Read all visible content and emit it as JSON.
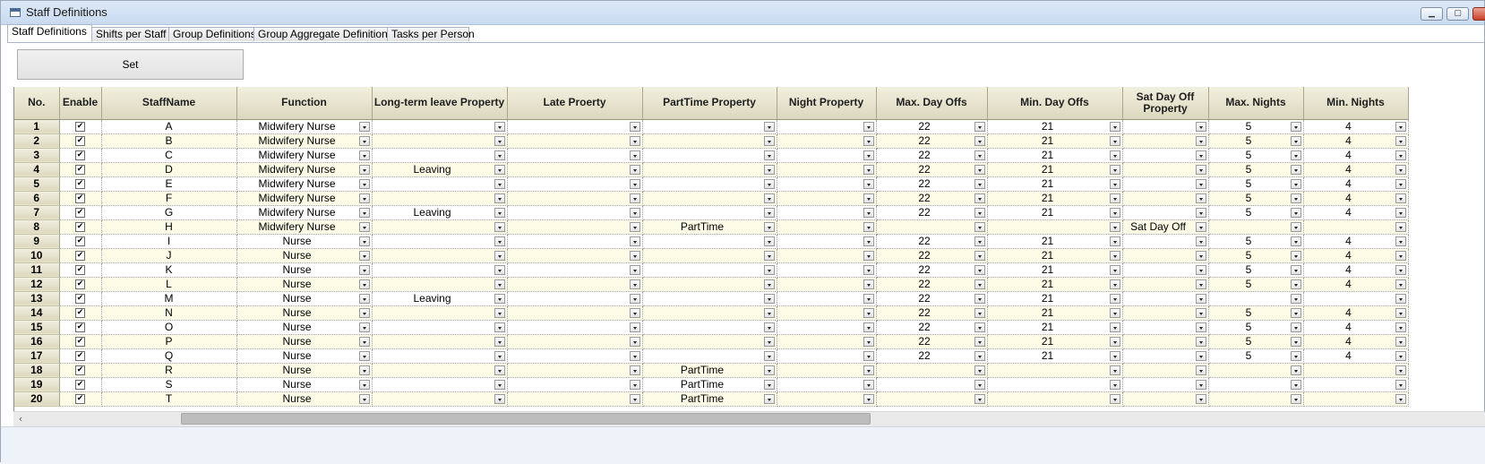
{
  "window": {
    "title": "Staff Definitions",
    "min_symbol": "▁",
    "max_symbol": "▢",
    "close_symbol": ""
  },
  "tabs": [
    "Staff Definitions",
    "Shifts per Staff",
    "Group Definitions",
    "Group Aggregate Definitions",
    "Tasks per Person"
  ],
  "set_button": "Set",
  "columns": [
    "No.",
    "Enable",
    "StaffName",
    "Function",
    "Long-term leave Property",
    "Late Proerty",
    "PartTime Property",
    "Night Property",
    "Max. Day Offs",
    "Min. Day Offs",
    "Sat Day Off Property",
    "Max. Nights",
    "Min. Nights"
  ],
  "check_symbol": "✔",
  "scroll_left_symbol": "‹",
  "rows": [
    {
      "no": "1",
      "name": "A",
      "function": "Midwifery Nurse",
      "leave": "",
      "late": "",
      "parttime": "",
      "night": "",
      "max_off": "22",
      "min_off": "21",
      "sat": "",
      "max_n": "5",
      "min_n": "4"
    },
    {
      "no": "2",
      "name": "B",
      "function": "Midwifery Nurse",
      "leave": "",
      "late": "",
      "parttime": "",
      "night": "",
      "max_off": "22",
      "min_off": "21",
      "sat": "",
      "max_n": "5",
      "min_n": "4"
    },
    {
      "no": "3",
      "name": "C",
      "function": "Midwifery Nurse",
      "leave": "",
      "late": "",
      "parttime": "",
      "night": "",
      "max_off": "22",
      "min_off": "21",
      "sat": "",
      "max_n": "5",
      "min_n": "4"
    },
    {
      "no": "4",
      "name": "D",
      "function": "Midwifery Nurse",
      "leave": "Leaving",
      "late": "",
      "parttime": "",
      "night": "",
      "max_off": "22",
      "min_off": "21",
      "sat": "",
      "max_n": "5",
      "min_n": "4"
    },
    {
      "no": "5",
      "name": "E",
      "function": "Midwifery Nurse",
      "leave": "",
      "late": "",
      "parttime": "",
      "night": "",
      "max_off": "22",
      "min_off": "21",
      "sat": "",
      "max_n": "5",
      "min_n": "4"
    },
    {
      "no": "6",
      "name": "F",
      "function": "Midwifery Nurse",
      "leave": "",
      "late": "",
      "parttime": "",
      "night": "",
      "max_off": "22",
      "min_off": "21",
      "sat": "",
      "max_n": "5",
      "min_n": "4"
    },
    {
      "no": "7",
      "name": "G",
      "function": "Midwifery Nurse",
      "leave": "Leaving",
      "late": "",
      "parttime": "",
      "night": "",
      "max_off": "22",
      "min_off": "21",
      "sat": "",
      "max_n": "5",
      "min_n": "4"
    },
    {
      "no": "8",
      "name": "H",
      "function": "Midwifery Nurse",
      "leave": "",
      "late": "",
      "parttime": "PartTime",
      "night": "",
      "max_off": "",
      "min_off": "",
      "sat": "Sat Day Off",
      "max_n": "",
      "min_n": ""
    },
    {
      "no": "9",
      "name": "I",
      "function": "Nurse",
      "leave": "",
      "late": "",
      "parttime": "",
      "night": "",
      "max_off": "22",
      "min_off": "21",
      "sat": "",
      "max_n": "5",
      "min_n": "4"
    },
    {
      "no": "10",
      "name": "J",
      "function": "Nurse",
      "leave": "",
      "late": "",
      "parttime": "",
      "night": "",
      "max_off": "22",
      "min_off": "21",
      "sat": "",
      "max_n": "5",
      "min_n": "4"
    },
    {
      "no": "11",
      "name": "K",
      "function": "Nurse",
      "leave": "",
      "late": "",
      "parttime": "",
      "night": "",
      "max_off": "22",
      "min_off": "21",
      "sat": "",
      "max_n": "5",
      "min_n": "4"
    },
    {
      "no": "12",
      "name": "L",
      "function": "Nurse",
      "leave": "",
      "late": "",
      "parttime": "",
      "night": "",
      "max_off": "22",
      "min_off": "21",
      "sat": "",
      "max_n": "5",
      "min_n": "4"
    },
    {
      "no": "13",
      "name": "M",
      "function": "Nurse",
      "leave": "Leaving",
      "late": "",
      "parttime": "",
      "night": "",
      "max_off": "22",
      "min_off": "21",
      "sat": "",
      "max_n": "",
      "min_n": ""
    },
    {
      "no": "14",
      "name": "N",
      "function": "Nurse",
      "leave": "",
      "late": "",
      "parttime": "",
      "night": "",
      "max_off": "22",
      "min_off": "21",
      "sat": "",
      "max_n": "5",
      "min_n": "4"
    },
    {
      "no": "15",
      "name": "O",
      "function": "Nurse",
      "leave": "",
      "late": "",
      "parttime": "",
      "night": "",
      "max_off": "22",
      "min_off": "21",
      "sat": "",
      "max_n": "5",
      "min_n": "4"
    },
    {
      "no": "16",
      "name": "P",
      "function": "Nurse",
      "leave": "",
      "late": "",
      "parttime": "",
      "night": "",
      "max_off": "22",
      "min_off": "21",
      "sat": "",
      "max_n": "5",
      "min_n": "4"
    },
    {
      "no": "17",
      "name": "Q",
      "function": "Nurse",
      "leave": "",
      "late": "",
      "parttime": "",
      "night": "",
      "max_off": "22",
      "min_off": "21",
      "sat": "",
      "max_n": "5",
      "min_n": "4"
    },
    {
      "no": "18",
      "name": "R",
      "function": "Nurse",
      "leave": "",
      "late": "",
      "parttime": "PartTime",
      "night": "",
      "max_off": "",
      "min_off": "",
      "sat": "",
      "max_n": "",
      "min_n": ""
    },
    {
      "no": "19",
      "name": "S",
      "function": "Nurse",
      "leave": "",
      "late": "",
      "parttime": "PartTime",
      "night": "",
      "max_off": "",
      "min_off": "",
      "sat": "",
      "max_n": "",
      "min_n": ""
    },
    {
      "no": "20",
      "name": "T",
      "function": "Nurse",
      "leave": "",
      "late": "",
      "parttime": "PartTime",
      "night": "",
      "max_off": "",
      "min_off": "",
      "sat": "",
      "max_n": "",
      "min_n": ""
    }
  ]
}
